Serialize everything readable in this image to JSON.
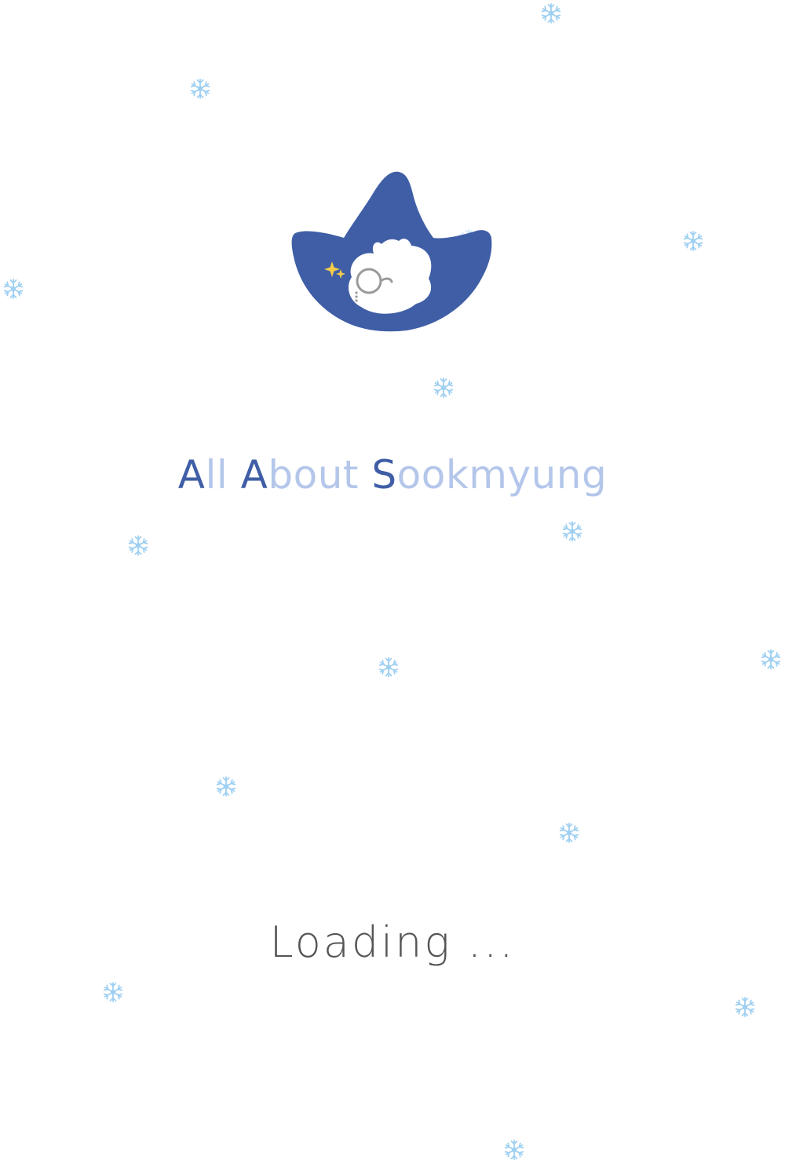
{
  "screen": {
    "background_color": "#ffffff"
  },
  "logo": {
    "icon": "hat-mascot-logo-icon",
    "hat_color": "#3f5ea6",
    "face_color": "#ffffff",
    "monocle_color": "#9a9a9a",
    "sparkle_color": "#f5cd4a"
  },
  "app_name": {
    "parts": [
      {
        "text": "A",
        "style": "initial"
      },
      {
        "text": "ll ",
        "style": "rest"
      },
      {
        "text": "A",
        "style": "initial"
      },
      {
        "text": "bout ",
        "style": "rest"
      },
      {
        "text": "S",
        "style": "initial"
      },
      {
        "text": "ookmyung",
        "style": "rest"
      }
    ],
    "initial_color": "#3f5ea6",
    "rest_color": "#b4c6ea"
  },
  "loading": {
    "text": "Loading ...",
    "color": "#555555"
  },
  "snowflakes": {
    "icon": "snowflake-icon",
    "color": "#9fd0f2",
    "count": 18
  }
}
